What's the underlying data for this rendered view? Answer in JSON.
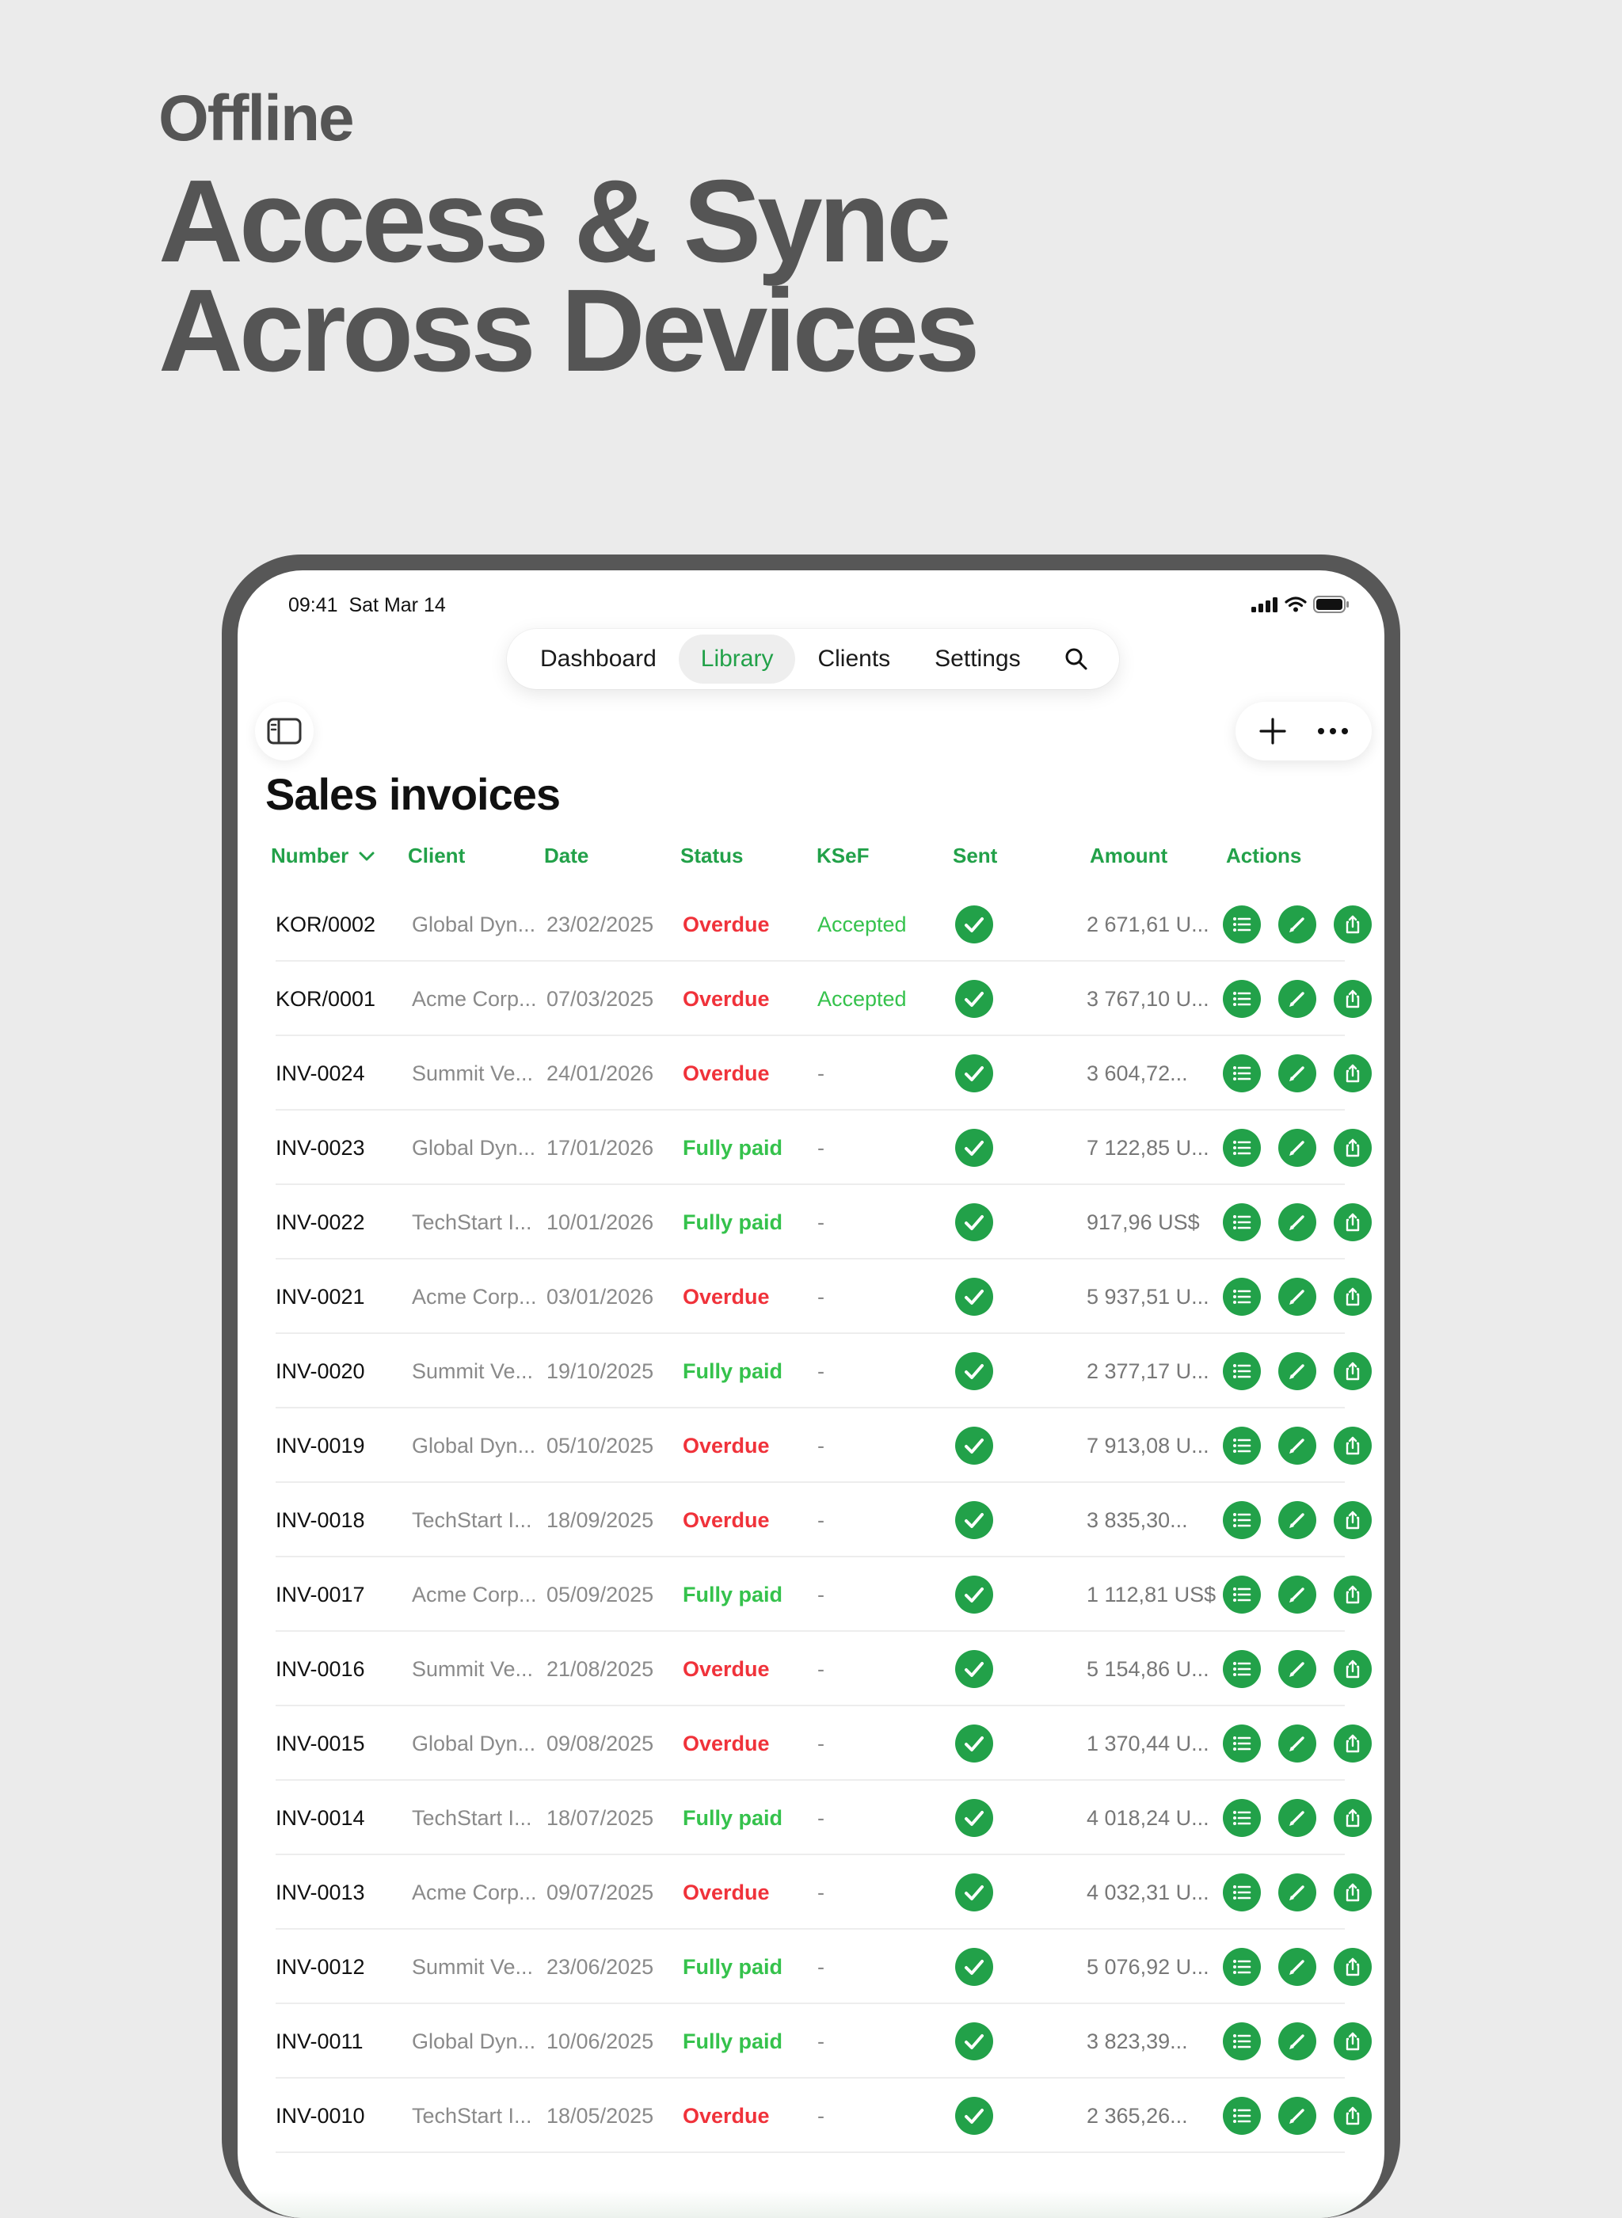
{
  "promo": {
    "kicker": "Offline",
    "title_line1": "Access & Sync",
    "title_line2": "Across Devices"
  },
  "status_bar": {
    "time": "09:41",
    "date": "Sat Mar 14"
  },
  "nav": {
    "tabs": [
      {
        "label": "Dashboard",
        "active": false
      },
      {
        "label": "Library",
        "active": true
      },
      {
        "label": "Clients",
        "active": false
      },
      {
        "label": "Settings",
        "active": false
      }
    ]
  },
  "page": {
    "title": "Sales invoices"
  },
  "table": {
    "columns": [
      "Number",
      "Client",
      "Date",
      "Status",
      "KSeF",
      "Sent",
      "Amount",
      "Actions"
    ],
    "sort_column": "Number",
    "rows": [
      {
        "number": "KOR/0002",
        "client": "Global Dyn...",
        "date": "23/02/2025",
        "status": "Overdue",
        "ksef": "Accepted",
        "amount": "2 671,61 U..."
      },
      {
        "number": "KOR/0001",
        "client": "Acme Corp...",
        "date": "07/03/2025",
        "status": "Overdue",
        "ksef": "Accepted",
        "amount": "3 767,10 U..."
      },
      {
        "number": "INV-0024",
        "client": "Summit Ve...",
        "date": "24/01/2026",
        "status": "Overdue",
        "ksef": "-",
        "amount": "3 604,72..."
      },
      {
        "number": "INV-0023",
        "client": "Global Dyn...",
        "date": "17/01/2026",
        "status": "Fully paid",
        "ksef": "-",
        "amount": "7 122,85 U..."
      },
      {
        "number": "INV-0022",
        "client": "TechStart I...",
        "date": "10/01/2026",
        "status": "Fully paid",
        "ksef": "-",
        "amount": "917,96 US$"
      },
      {
        "number": "INV-0021",
        "client": "Acme Corp...",
        "date": "03/01/2026",
        "status": "Overdue",
        "ksef": "-",
        "amount": "5 937,51 U..."
      },
      {
        "number": "INV-0020",
        "client": "Summit Ve...",
        "date": "19/10/2025",
        "status": "Fully paid",
        "ksef": "-",
        "amount": "2 377,17 U..."
      },
      {
        "number": "INV-0019",
        "client": "Global Dyn...",
        "date": "05/10/2025",
        "status": "Overdue",
        "ksef": "-",
        "amount": "7 913,08 U..."
      },
      {
        "number": "INV-0018",
        "client": "TechStart I...",
        "date": "18/09/2025",
        "status": "Overdue",
        "ksef": "-",
        "amount": "3 835,30..."
      },
      {
        "number": "INV-0017",
        "client": "Acme Corp...",
        "date": "05/09/2025",
        "status": "Fully paid",
        "ksef": "-",
        "amount": "1 112,81 US$"
      },
      {
        "number": "INV-0016",
        "client": "Summit Ve...",
        "date": "21/08/2025",
        "status": "Overdue",
        "ksef": "-",
        "amount": "5 154,86 U..."
      },
      {
        "number": "INV-0015",
        "client": "Global Dyn...",
        "date": "09/08/2025",
        "status": "Overdue",
        "ksef": "-",
        "amount": "1 370,44 U..."
      },
      {
        "number": "INV-0014",
        "client": "TechStart I...",
        "date": "18/07/2025",
        "status": "Fully paid",
        "ksef": "-",
        "amount": "4 018,24 U..."
      },
      {
        "number": "INV-0013",
        "client": "Acme Corp...",
        "date": "09/07/2025",
        "status": "Overdue",
        "ksef": "-",
        "amount": "4 032,31 U..."
      },
      {
        "number": "INV-0012",
        "client": "Summit Ve...",
        "date": "23/06/2025",
        "status": "Fully paid",
        "ksef": "-",
        "amount": "5 076,92 U..."
      },
      {
        "number": "INV-0011",
        "client": "Global Dyn...",
        "date": "10/06/2025",
        "status": "Fully paid",
        "ksef": "-",
        "amount": "3 823,39..."
      },
      {
        "number": "INV-0010",
        "client": "TechStart I...",
        "date": "18/05/2025",
        "status": "Overdue",
        "ksef": "-",
        "amount": "2 365,26..."
      }
    ]
  },
  "icons": {
    "sent": "checkmark-circle-icon",
    "actions": [
      "list-icon",
      "edit-pencil-icon",
      "share-icon"
    ]
  },
  "colors": {
    "accent": "#22a149",
    "overdue": "#f0323a",
    "paid": "#35c24c",
    "background": "#ebebeb",
    "device_frame": "#575757"
  }
}
